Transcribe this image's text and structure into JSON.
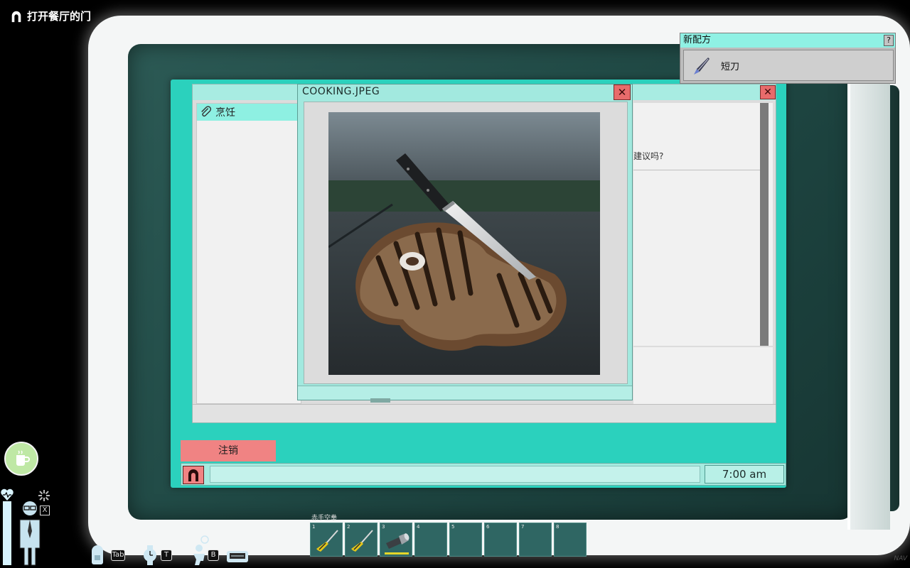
{
  "objective": {
    "text": "打开餐厅的门",
    "icon": "arch-door-icon"
  },
  "app": {
    "sidebar_item": "烹饪",
    "sidebar_icon": "paperclip-icon",
    "content_snippet": "建议吗?",
    "close_label": "✕"
  },
  "viewer": {
    "title": "COOKING.JPEG",
    "close_label": "✕",
    "image": "steak-with-knife-photo"
  },
  "taskbar": {
    "logout_label": "注销",
    "start_icon": "arch-door-icon",
    "clock": "7:00 am"
  },
  "recipe_popup": {
    "header": "新配方",
    "help_label": "?",
    "item_name": "短刀",
    "item_icon": "knife-icon"
  },
  "hud": {
    "stamina_key": "X",
    "inventory_key": "Tab",
    "watch_key": "T",
    "build_key": "B"
  },
  "hotbar": {
    "label": "赤手空拳",
    "slots": [
      {
        "num": "1",
        "item": "screwdriver-icon"
      },
      {
        "num": "2",
        "item": "screwdriver-icon"
      },
      {
        "num": "3",
        "item": "flashlight-icon"
      },
      {
        "num": "4",
        "item": ""
      },
      {
        "num": "5",
        "item": ""
      },
      {
        "num": "6",
        "item": ""
      },
      {
        "num": "7",
        "item": ""
      },
      {
        "num": "8",
        "item": ""
      }
    ]
  },
  "nav_label": "NAV",
  "colors": {
    "screen": "#2bd1bd",
    "titlebar": "#a8ece2",
    "close": "#e86b6b",
    "logout": "#f08383",
    "hotbar_slot": "#2f6663",
    "durability": "#e5d62a"
  }
}
